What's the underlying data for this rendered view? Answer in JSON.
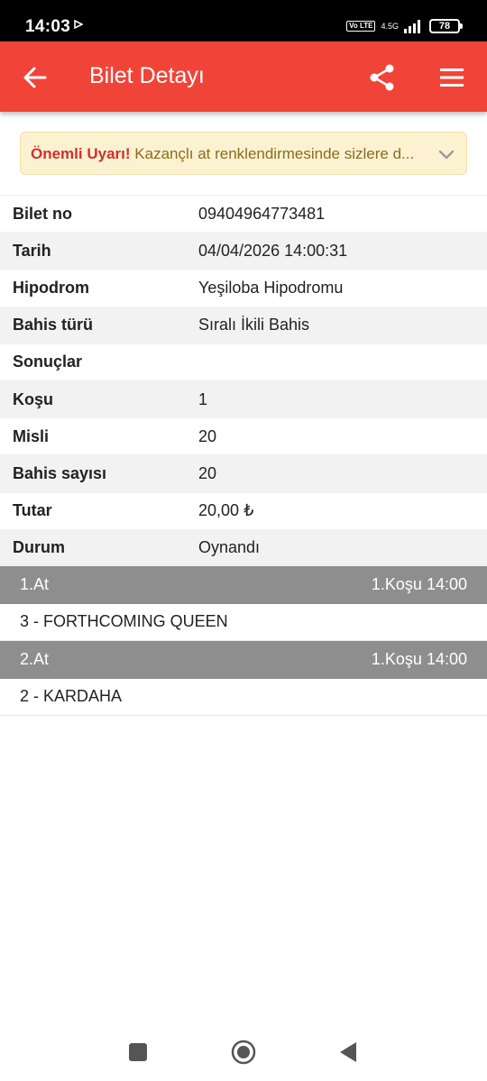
{
  "status_bar": {
    "time": "14:03",
    "volte": "Vo LTE",
    "network": "4.5G",
    "battery": "78"
  },
  "app_bar": {
    "title": "Bilet Detayı",
    "back_icon": "arrow-left-icon",
    "share_icon": "share-icon",
    "menu_icon": "hamburger-menu-icon",
    "color": "#f04438"
  },
  "warning": {
    "strong": "Önemli Uyarı!",
    "text": " Kazançlı at renklendirmesinde sizlere d...",
    "background": "#fcf2d1"
  },
  "details": [
    {
      "label": "Bilet no",
      "value": "09404964773481"
    },
    {
      "label": "Tarih",
      "value": "04/04/2026 14:00:31"
    },
    {
      "label": "Hipodrom",
      "value": "Yeşiloba Hipodromu"
    },
    {
      "label": "Bahis türü",
      "value": "Sıralı İkili Bahis"
    },
    {
      "label": "Sonuçlar",
      "value": ""
    },
    {
      "label": "Koşu",
      "value": "1"
    },
    {
      "label": "Misli",
      "value": "20"
    },
    {
      "label": "Bahis sayısı",
      "value": "20"
    },
    {
      "label": "Tutar",
      "value": "20,00 ₺"
    },
    {
      "label": "Durum",
      "value": "Oynandı"
    }
  ],
  "horses": [
    {
      "title": "1.At",
      "race": "1.Koşu 14:00",
      "horse": "3 - FORTHCOMING QUEEN"
    },
    {
      "title": "2.At",
      "race": "1.Koşu 14:00",
      "horse": "2 - KARDAHA"
    }
  ]
}
